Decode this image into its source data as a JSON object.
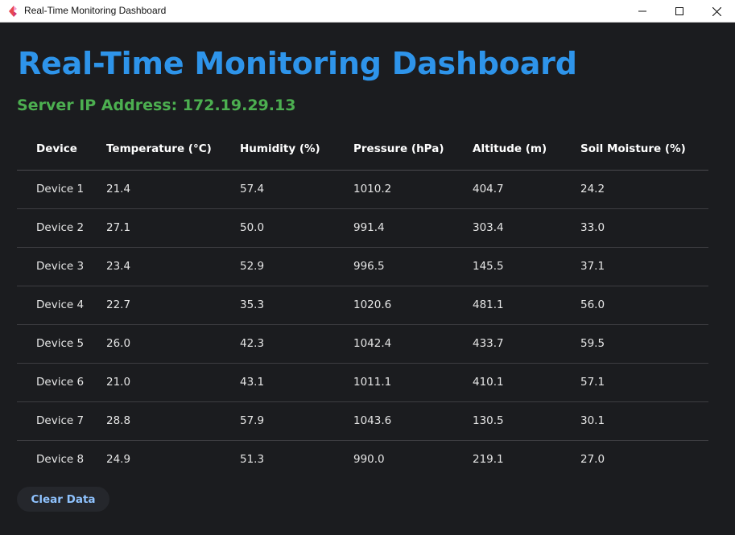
{
  "window": {
    "title": "Real-Time Monitoring Dashboard",
    "icon": "app-logo-icon",
    "controls": [
      "minimize-icon",
      "maximize-icon",
      "close-icon"
    ]
  },
  "header": {
    "title": "Real-Time Monitoring Dashboard",
    "server_ip": "Server IP Address: 172.19.29.13"
  },
  "table": {
    "columns": [
      "Device",
      "Temperature (°C)",
      "Humidity (%)",
      "Pressure (hPa)",
      "Altitude (m)",
      "Soil Moisture (%)"
    ],
    "rows": [
      [
        "Device 1",
        "21.4",
        "57.4",
        "1010.2",
        "404.7",
        "24.2"
      ],
      [
        "Device 2",
        "27.1",
        "50.0",
        "991.4",
        "303.4",
        "33.0"
      ],
      [
        "Device 3",
        "23.4",
        "52.9",
        "996.5",
        "145.5",
        "37.1"
      ],
      [
        "Device 4",
        "22.7",
        "35.3",
        "1020.6",
        "481.1",
        "56.0"
      ],
      [
        "Device 5",
        "26.0",
        "42.3",
        "1042.4",
        "433.7",
        "59.5"
      ],
      [
        "Device 6",
        "21.0",
        "43.1",
        "1011.1",
        "410.1",
        "57.1"
      ],
      [
        "Device 7",
        "28.8",
        "57.9",
        "1043.6",
        "130.5",
        "30.1"
      ],
      [
        "Device 8",
        "24.9",
        "51.3",
        "990.0",
        "219.1",
        "27.0"
      ]
    ]
  },
  "actions": {
    "clear_label": "Clear Data"
  },
  "colors": {
    "background": "#1b1c1f",
    "title": "#2e94ea",
    "server_ip": "#4caf50",
    "button_text": "#8fc3ff"
  }
}
